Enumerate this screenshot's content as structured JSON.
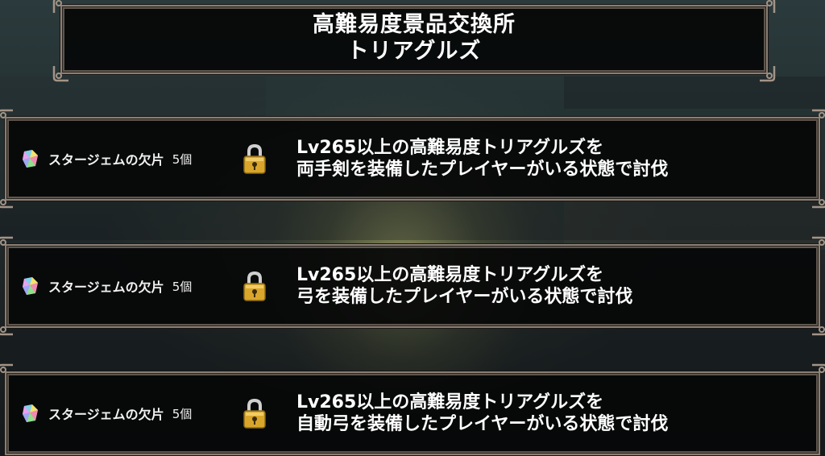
{
  "header": {
    "title_line1": "高難易度景品交換所",
    "title_line2": "トリアグルズ"
  },
  "missions": [
    {
      "reward_name": "スタージェムの欠片",
      "reward_qty": "5個",
      "reward_icon": "star-gem-fragment-icon",
      "lock_icon": "padlock-icon",
      "condition_line1": "Lv265以上の高難易度トリアグルズを",
      "condition_line2": "両手剣を装備したプレイヤーがいる状態で討伐"
    },
    {
      "reward_name": "スタージェムの欠片",
      "reward_qty": "5個",
      "reward_icon": "star-gem-fragment-icon",
      "lock_icon": "padlock-icon",
      "condition_line1": "Lv265以上の高難易度トリアグルズを",
      "condition_line2": "弓を装備したプレイヤーがいる状態で討伐"
    },
    {
      "reward_name": "スタージェムの欠片",
      "reward_qty": "5個",
      "reward_icon": "star-gem-fragment-icon",
      "lock_icon": "padlock-icon",
      "condition_line1": "Lv265以上の高難易度トリアグルズを",
      "condition_line2": "自動弓を装備したプレイヤーがいる状態で討伐"
    }
  ],
  "colors": {
    "frame_border": "#8a7f74",
    "panel_bg": "#060708",
    "text": "#ffffff",
    "lock_gold": "#d9a62b"
  }
}
